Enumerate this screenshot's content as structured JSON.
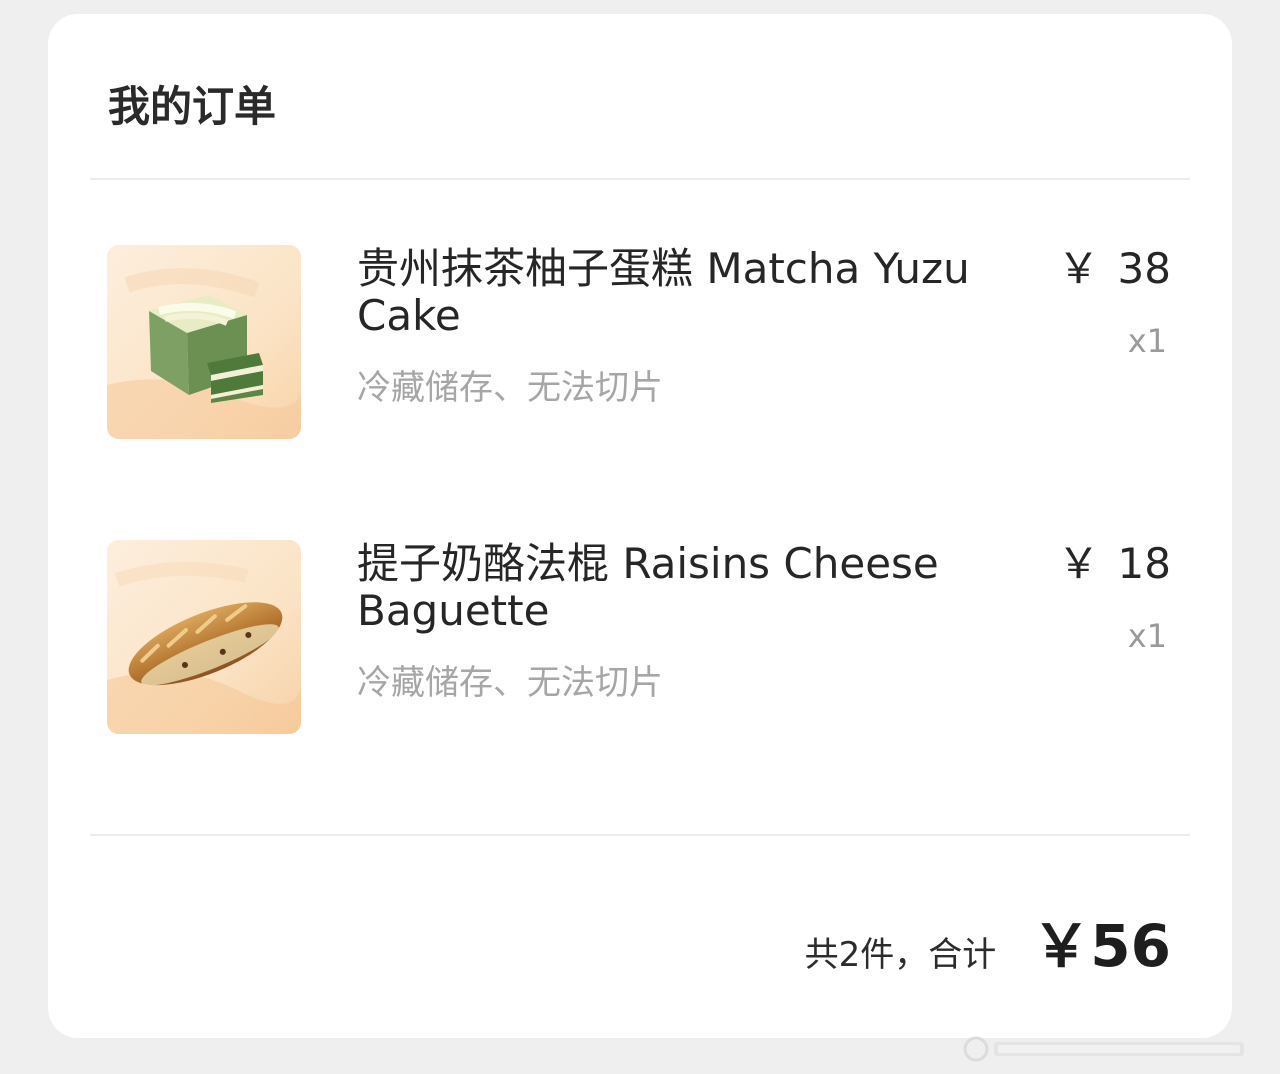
{
  "header": {
    "title": "我的订单"
  },
  "items": [
    {
      "name": "贵州抹茶柚子蛋糕 Matcha Yuzu Cake",
      "note": "冷藏储存、无法切片",
      "currency": "￥",
      "price": "38",
      "quantity": "x1",
      "image_icon": "matcha-cake-image"
    },
    {
      "name": "提子奶酪法棍 Raisins Cheese Baguette",
      "note": "冷藏储存、无法切片",
      "currency": "￥",
      "price": "18",
      "quantity": "x1",
      "image_icon": "baguette-image"
    }
  ],
  "summary": {
    "count_text": "共2件，合计",
    "total": "￥56"
  },
  "colors": {
    "background": "#efefef",
    "card": "#ffffff",
    "muted_text": "#a6a6a6"
  }
}
